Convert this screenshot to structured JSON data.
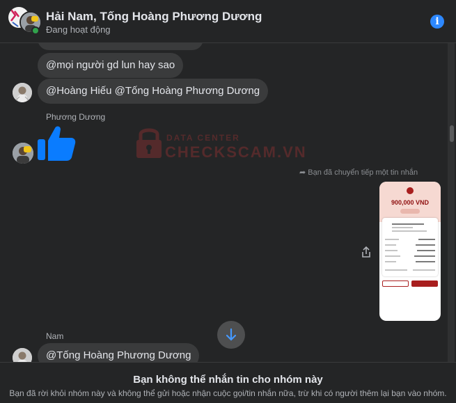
{
  "header": {
    "title": "Hải Nam, Tống Hoàng Phương Dương",
    "status": "Đang hoạt động",
    "info_icon": "info-icon"
  },
  "messages": [
    {
      "sender": "",
      "text": "@mọi người  gd lun hay sao"
    },
    {
      "sender": "",
      "text": "@Hoàng Hiếu @Tống Hoàng Phương Dương"
    },
    {
      "sender": "Phương Dương",
      "text": "",
      "icon": "thumbs-up-icon"
    },
    {
      "sender": "",
      "text": "Bạn đã chuyển tiếp một tin nhắn",
      "type": "forwarded-image"
    },
    {
      "sender": "Nam",
      "text": "@Tống Hoàng Phương Dương"
    }
  ],
  "watermark": {
    "line1": "DATA CENTER",
    "line2": "CHECKSCAM.VN"
  },
  "receipt": {
    "amount": "900,000 VND",
    "recipient": "TONG HOANG PHUONG DUONG"
  },
  "footer": {
    "title": "Bạn không thể nhắn tin cho nhóm này",
    "subtitle": "Bạn đã rời khỏi nhóm này và không thể gửi hoặc nhận cuộc gọi/tin nhắn nữa, trừ khi có người thêm lại bạn vào nhóm."
  },
  "colors": {
    "background": "#242526",
    "bubble": "#3a3b3c",
    "accent": "#2d88ff",
    "online": "#31a24c",
    "watermark": "#d23a3a"
  }
}
